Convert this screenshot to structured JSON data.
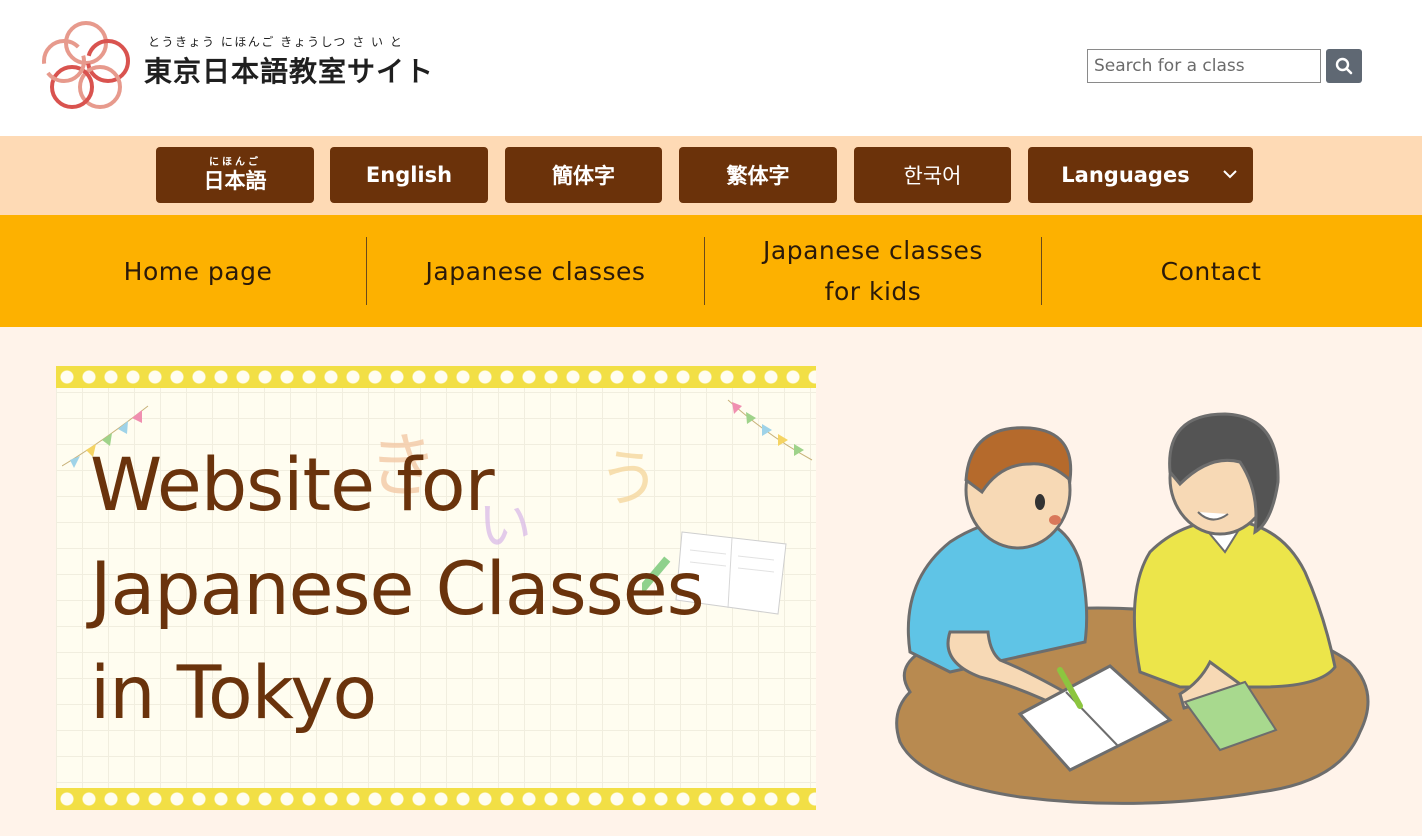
{
  "header": {
    "logo_ruby": "とうきょう にほんご きょうしつ さ い と",
    "logo_title": "東京日本語教室サイト",
    "search_placeholder": "Search for a class",
    "search_icon": "search-icon"
  },
  "language_bar": {
    "items": [
      {
        "label": "日本語",
        "ruby": "にほんご"
      },
      {
        "label": "English"
      },
      {
        "label": "簡体字"
      },
      {
        "label": "繁体字"
      },
      {
        "label": "한국어"
      },
      {
        "label": "Languages",
        "icon": "chevron-down-icon"
      }
    ]
  },
  "main_nav": {
    "items": [
      {
        "label": "Home page"
      },
      {
        "label": "Japanese classes"
      },
      {
        "label_line1": "Japanese classes",
        "label_line2": "for kids"
      },
      {
        "label": "Contact"
      }
    ]
  },
  "hero": {
    "title_line1": "Website for",
    "title_line2": "Japanese Classes",
    "title_line3": "in Tokyo"
  },
  "colors": {
    "lang_bar_bg": "#fedab5",
    "lang_button": "#6b320a",
    "nav_bg": "#fdb100",
    "page_bg": "#fff3ea",
    "hero_text": "#6a330c",
    "logo_accent": "#d9534f"
  }
}
